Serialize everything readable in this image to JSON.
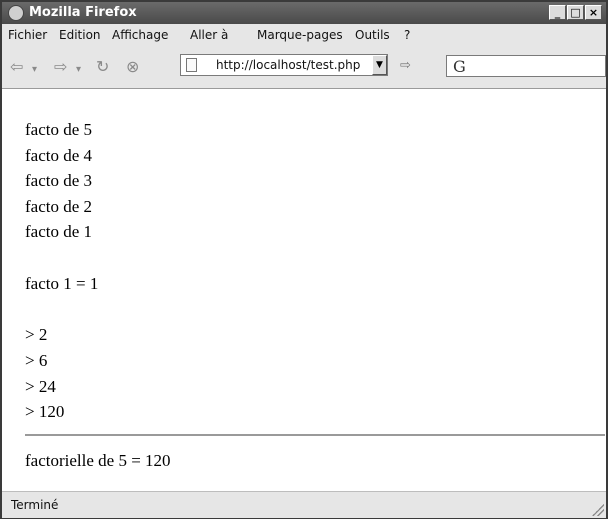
{
  "window": {
    "title": "Mozilla Firefox"
  },
  "menu": [
    {
      "label": "Fichier"
    },
    {
      "label": "Edition"
    },
    {
      "label": "Affichage"
    },
    {
      "label": "Aller à"
    },
    {
      "label": "Marque-pages"
    },
    {
      "label": "Outils"
    },
    {
      "label": "?"
    }
  ],
  "toolbar": {
    "url": "http://localhost/test.php"
  },
  "content": {
    "lines": [
      "facto de 5",
      "facto de 4",
      "facto de 3",
      "facto de 2",
      "facto de 1",
      "",
      "facto 1 = 1",
      "",
      "> 2",
      "> 6",
      "> 24",
      "> 120"
    ],
    "result": "factorielle de 5 = 120"
  },
  "status": {
    "text": "Terminé"
  }
}
